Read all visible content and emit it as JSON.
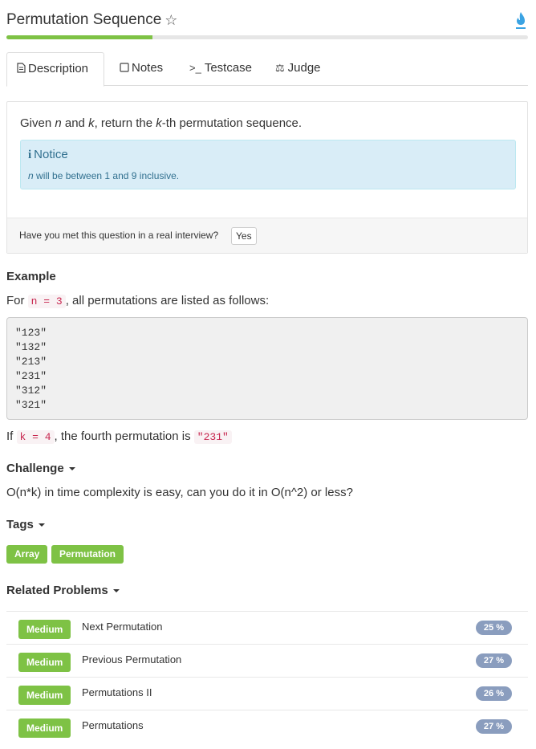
{
  "header": {
    "title": "Permutation Sequence",
    "star_glyph": "☆",
    "progress_percent": 28
  },
  "tabs": [
    {
      "label": "Description",
      "icon": "document-icon",
      "active": true
    },
    {
      "label": "Notes",
      "icon": "note-icon",
      "active": false
    },
    {
      "label": "Testcase",
      "icon": "terminal-icon",
      "active": false
    },
    {
      "label": "Judge",
      "icon": "scale-icon",
      "active": false
    }
  ],
  "description": {
    "text_pre": "Given ",
    "var_n": "n",
    "text_and": " and ",
    "var_k": "k",
    "text_return": ", return the ",
    "var_k2": "k",
    "text_post": "-th permutation sequence.",
    "notice_title": "Notice",
    "notice_var": "n",
    "notice_body": " will be between 1 and 9 inclusive."
  },
  "interview": {
    "question": "Have you met this question in a real interview?",
    "yes_label": "Yes"
  },
  "example": {
    "heading": "Example",
    "line1_pre": "For ",
    "line1_code": "n = 3",
    "line1_post": ", all permutations are listed as follows:",
    "code_lines": [
      "\"123\"",
      "\"132\"",
      "\"213\"",
      "\"231\"",
      "\"312\"",
      "\"321\""
    ],
    "line2_pre": "If ",
    "line2_code": "k = 4",
    "line2_mid": ", the fourth permutation is ",
    "line2_code2": "\"231\""
  },
  "challenge": {
    "heading": "Challenge",
    "text": "O(n*k) in time complexity is easy, can you do it in O(n^2) or less?"
  },
  "tags": {
    "heading": "Tags",
    "items": [
      "Array",
      "Permutation"
    ]
  },
  "related": {
    "heading": "Related Problems",
    "items": [
      {
        "difficulty": "Medium",
        "title": "Next Permutation",
        "percent": "25 %"
      },
      {
        "difficulty": "Medium",
        "title": "Previous Permutation",
        "percent": "27 %"
      },
      {
        "difficulty": "Medium",
        "title": "Permutations II",
        "percent": "26 %"
      },
      {
        "difficulty": "Medium",
        "title": "Permutations",
        "percent": "27 %"
      }
    ]
  },
  "colors": {
    "accent_green": "#7ec245",
    "percent_badge": "#8a9dbe",
    "notice_bg": "#d9edf7",
    "code_red": "#c7254e",
    "flame_blue": "#3aa3e3"
  }
}
